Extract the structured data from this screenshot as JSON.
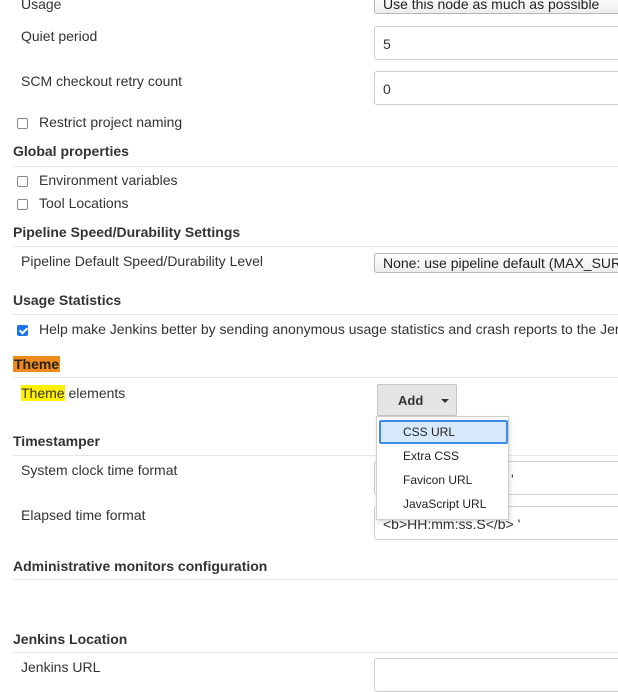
{
  "general": {
    "usage_label": "Usage",
    "usage_value": "Use this node as much as possible",
    "quiet_period_label": "Quiet period",
    "quiet_period_value": "5",
    "scm_retry_label": "SCM checkout retry count",
    "scm_retry_value": "0",
    "restrict_naming_label": "Restrict project naming",
    "restrict_naming_checked": false
  },
  "global_properties": {
    "title": "Global properties",
    "env_vars_label": "Environment variables",
    "tool_locations_label": "Tool Locations"
  },
  "pipeline": {
    "title": "Pipeline Speed/Durability Settings",
    "level_label": "Pipeline Default Speed/Durability Level",
    "level_value": "None: use pipeline default (MAX_SUR"
  },
  "usage_statistics": {
    "title": "Usage Statistics",
    "help_label": "Help make Jenkins better by sending anonymous usage statistics and crash reports to the Jer",
    "help_checked": true
  },
  "theme": {
    "title": "Theme",
    "elements_label_highlight": "Theme",
    "elements_label_rest": " elements",
    "add_button": "Add",
    "menu_items": [
      "CSS URL",
      "Extra CSS",
      "Favicon URL",
      "JavaScript URL"
    ],
    "active_item": "CSS URL"
  },
  "timestamper": {
    "title": "Timestamper",
    "system_clock_label": "System clock time format",
    "system_clock_value": "'",
    "elapsed_label": "Elapsed time format",
    "elapsed_value": "<b>HH:mm:ss.S</b> '"
  },
  "admin_monitors": {
    "title": "Administrative monitors configuration"
  },
  "jenkins_location": {
    "title": "Jenkins Location",
    "url_label": "Jenkins URL"
  },
  "colors": {
    "theme_highlight": "#f08a1d",
    "search_highlight": "#fff200",
    "checkbox_accent": "#1a73e8",
    "menu_active_border": "#3d8be6"
  }
}
